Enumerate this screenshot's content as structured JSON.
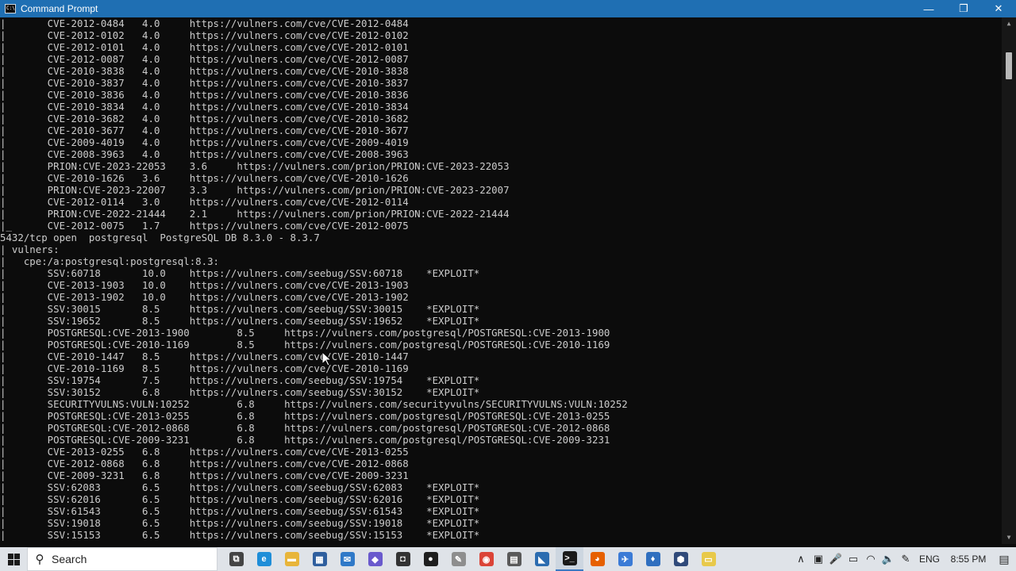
{
  "window": {
    "title": "Command Prompt",
    "controls": {
      "minimize": "—",
      "restore": "❐",
      "close": "✕"
    }
  },
  "terminal_lines": [
    "|       CVE-2012-0484   4.0     https://vulners.com/cve/CVE-2012-0484",
    "|       CVE-2012-0102   4.0     https://vulners.com/cve/CVE-2012-0102",
    "|       CVE-2012-0101   4.0     https://vulners.com/cve/CVE-2012-0101",
    "|       CVE-2012-0087   4.0     https://vulners.com/cve/CVE-2012-0087",
    "|       CVE-2010-3838   4.0     https://vulners.com/cve/CVE-2010-3838",
    "|       CVE-2010-3837   4.0     https://vulners.com/cve/CVE-2010-3837",
    "|       CVE-2010-3836   4.0     https://vulners.com/cve/CVE-2010-3836",
    "|       CVE-2010-3834   4.0     https://vulners.com/cve/CVE-2010-3834",
    "|       CVE-2010-3682   4.0     https://vulners.com/cve/CVE-2010-3682",
    "|       CVE-2010-3677   4.0     https://vulners.com/cve/CVE-2010-3677",
    "|       CVE-2009-4019   4.0     https://vulners.com/cve/CVE-2009-4019",
    "|       CVE-2008-3963   4.0     https://vulners.com/cve/CVE-2008-3963",
    "|       PRION:CVE-2023-22053    3.6     https://vulners.com/prion/PRION:CVE-2023-22053",
    "|       CVE-2010-1626   3.6     https://vulners.com/cve/CVE-2010-1626",
    "|       PRION:CVE-2023-22007    3.3     https://vulners.com/prion/PRION:CVE-2023-22007",
    "|       CVE-2012-0114   3.0     https://vulners.com/cve/CVE-2012-0114",
    "|       PRION:CVE-2022-21444    2.1     https://vulners.com/prion/PRION:CVE-2022-21444",
    "|_      CVE-2012-0075   1.7     https://vulners.com/cve/CVE-2012-0075",
    "5432/tcp open  postgresql  PostgreSQL DB 8.3.0 - 8.3.7",
    "| vulners:",
    "|   cpe:/a:postgresql:postgresql:8.3:",
    "|       SSV:60718       10.0    https://vulners.com/seebug/SSV:60718    *EXPLOIT*",
    "|       CVE-2013-1903   10.0    https://vulners.com/cve/CVE-2013-1903",
    "|       CVE-2013-1902   10.0    https://vulners.com/cve/CVE-2013-1902",
    "|       SSV:30015       8.5     https://vulners.com/seebug/SSV:30015    *EXPLOIT*",
    "|       SSV:19652       8.5     https://vulners.com/seebug/SSV:19652    *EXPLOIT*",
    "|       POSTGRESQL:CVE-2013-1900        8.5     https://vulners.com/postgresql/POSTGRESQL:CVE-2013-1900",
    "|       POSTGRESQL:CVE-2010-1169        8.5     https://vulners.com/postgresql/POSTGRESQL:CVE-2010-1169",
    "|       CVE-2010-1447   8.5     https://vulners.com/cve/CVE-2010-1447",
    "|       CVE-2010-1169   8.5     https://vulners.com/cve/CVE-2010-1169",
    "|       SSV:19754       7.5     https://vulners.com/seebug/SSV:19754    *EXPLOIT*",
    "|       SSV:30152       6.8     https://vulners.com/seebug/SSV:30152    *EXPLOIT*",
    "|       SECURITYVULNS:VULN:10252        6.8     https://vulners.com/securityvulns/SECURITYVULNS:VULN:10252",
    "|       POSTGRESQL:CVE-2013-0255        6.8     https://vulners.com/postgresql/POSTGRESQL:CVE-2013-0255",
    "|       POSTGRESQL:CVE-2012-0868        6.8     https://vulners.com/postgresql/POSTGRESQL:CVE-2012-0868",
    "|       POSTGRESQL:CVE-2009-3231        6.8     https://vulners.com/postgresql/POSTGRESQL:CVE-2009-3231",
    "|       CVE-2013-0255   6.8     https://vulners.com/cve/CVE-2013-0255",
    "|       CVE-2012-0868   6.8     https://vulners.com/cve/CVE-2012-0868",
    "|       CVE-2009-3231   6.8     https://vulners.com/cve/CVE-2009-3231",
    "|       SSV:62083       6.5     https://vulners.com/seebug/SSV:62083    *EXPLOIT*",
    "|       SSV:62016       6.5     https://vulners.com/seebug/SSV:62016    *EXPLOIT*",
    "|       SSV:61543       6.5     https://vulners.com/seebug/SSV:61543    *EXPLOIT*",
    "|       SSV:19018       6.5     https://vulners.com/seebug/SSV:19018    *EXPLOIT*",
    "|       SSV:15153       6.5     https://vulners.com/seebug/SSV:15153    *EXPLOIT*"
  ],
  "taskbar": {
    "search_placeholder": "Search",
    "apps": [
      {
        "icon": "task-view-icon",
        "glyph": "⧉",
        "color": "#444444"
      },
      {
        "icon": "edge-icon",
        "glyph": "e",
        "color": "#1f8ed8"
      },
      {
        "icon": "file-explorer-icon",
        "glyph": "▬",
        "color": "#e8b53a"
      },
      {
        "icon": "store-icon",
        "glyph": "▦",
        "color": "#2f5f9e"
      },
      {
        "icon": "mail-icon",
        "glyph": "✉",
        "color": "#2f79c8"
      },
      {
        "icon": "app-icon-purple",
        "glyph": "◆",
        "color": "#6a5acd"
      },
      {
        "icon": "app-icon-outline",
        "glyph": "◘",
        "color": "#333333"
      },
      {
        "icon": "app-icon-dark",
        "glyph": "●",
        "color": "#1e1e1e"
      },
      {
        "icon": "paint-icon",
        "glyph": "✎",
        "color": "#8e8e8e"
      },
      {
        "icon": "chrome-icon",
        "glyph": "◉",
        "color": "#db4437"
      },
      {
        "icon": "calculator-icon",
        "glyph": "▤",
        "color": "#5a5a5a"
      },
      {
        "icon": "vscode-icon",
        "glyph": "◣",
        "color": "#2b6cb0"
      },
      {
        "icon": "command-prompt-icon",
        "glyph": ">_",
        "color": "#1a1a1a"
      },
      {
        "icon": "firefox-icon",
        "glyph": "◕",
        "color": "#e66000"
      },
      {
        "icon": "app-icon-blue",
        "glyph": "✈",
        "color": "#3b7bd6"
      },
      {
        "icon": "droplet-icon",
        "glyph": "♦",
        "color": "#2f6fbf"
      },
      {
        "icon": "app-icon-cube",
        "glyph": "⬢",
        "color": "#304a7a"
      },
      {
        "icon": "sticky-notes-icon",
        "glyph": "▭",
        "color": "#e8c94a"
      }
    ],
    "tray": {
      "language": "ENG",
      "time": "8:55 PM"
    }
  },
  "colors": {
    "terminal_bg": "#0c0c0c",
    "terminal_fg": "#cccccc",
    "titlebar_bg": "#1f6fb3",
    "taskbar_bg": "#dfe3e8"
  }
}
